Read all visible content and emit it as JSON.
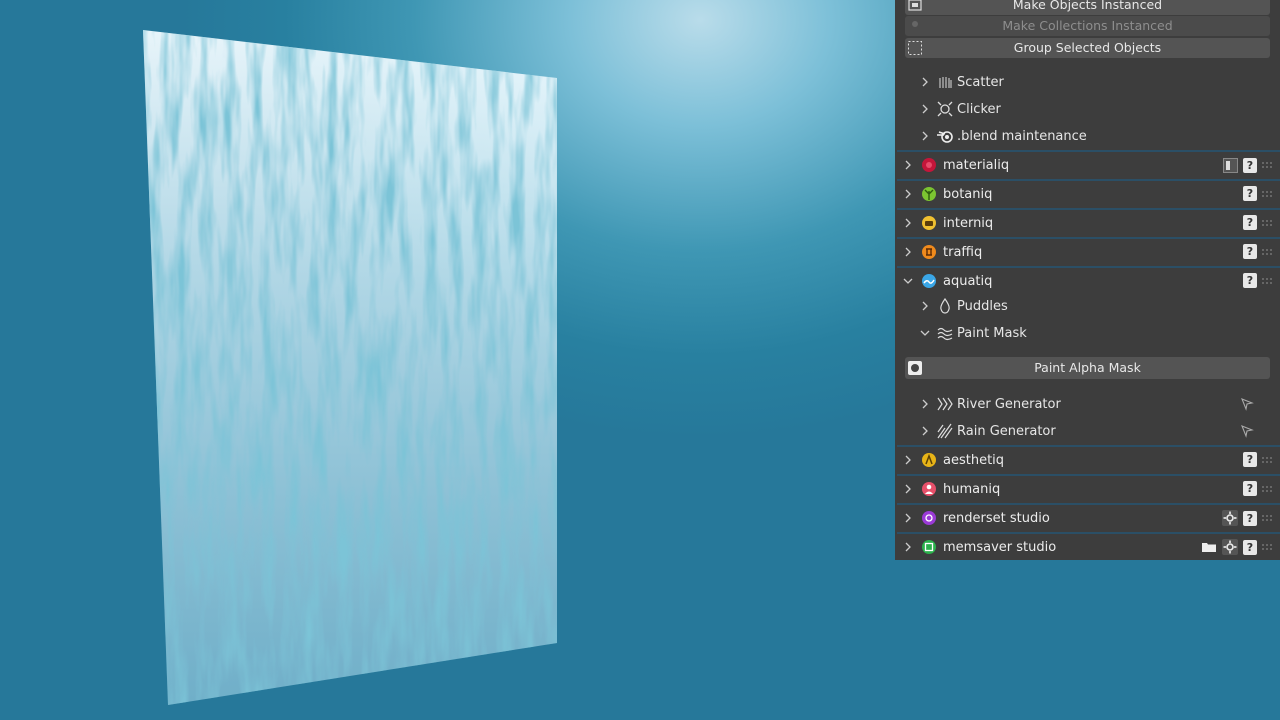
{
  "colors": {
    "panel_bg": "#3d3d3d",
    "header_border": "#2b4f66",
    "button_bg": "#545454",
    "viewport_water": "#2a82a3"
  },
  "buttons": {
    "make_objects_instanced": "Make Objects Instanced",
    "make_collections_instanced": "Make Collections Instanced",
    "group_selected_objects": "Group Selected Objects",
    "paint_alpha_mask": "Paint Alpha Mask"
  },
  "panels": {
    "scatter": "Scatter",
    "clicker": "Clicker",
    "blend_maintenance": ".blend maintenance",
    "materialiq": "materialiq",
    "botaniq": "botaniq",
    "interniq": "interniq",
    "traffiq": "traffiq",
    "aquatiq": "aquatiq",
    "puddles": "Puddles",
    "paint_mask": "Paint Mask",
    "river_generator": "River Generator",
    "rain_generator": "Rain Generator",
    "aesthetiq": "aesthetiq",
    "humaniq": "humaniq",
    "renderset_studio": "renderset studio",
    "memsaver_studio": "memsaver studio"
  },
  "help_label": "?"
}
